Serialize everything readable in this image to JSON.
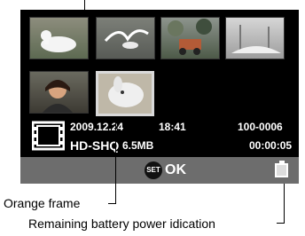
{
  "display": {
    "date": "2009.12.24",
    "time": "18:41",
    "file_number": "100-0006",
    "mode": "HD-SHQ",
    "size": "6.5MB",
    "duration": "00:00:05"
  },
  "bottom_bar": {
    "set_label": "SET",
    "ok_label": "OK"
  },
  "callouts": {
    "frame": "Orange frame",
    "battery": "Remaining battery power idication"
  },
  "icons": {
    "movie": "film-icon",
    "battery": "battery-icon",
    "set": "set-button-icon"
  }
}
